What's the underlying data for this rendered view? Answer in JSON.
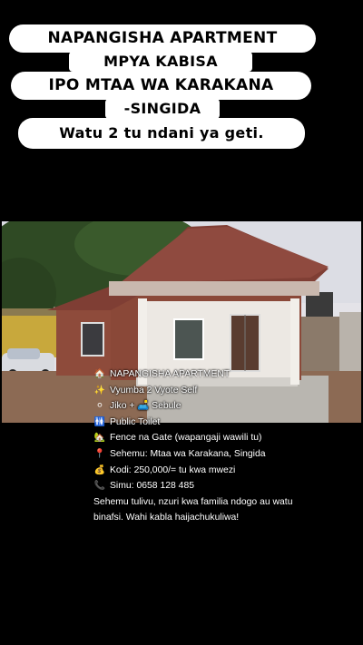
{
  "headline": {
    "line1": "NAPANGISHA APARTMENT",
    "line2": "MPYA KABISA",
    "line3": "IPO MTAA WA KARAKANA",
    "line4": "-SINGIDA",
    "line5": "Watu 2 tu ndani ya geti."
  },
  "photo": {
    "subject": "house-photo"
  },
  "post": {
    "items": [
      {
        "icon": "house-icon",
        "glyph": "🏠",
        "text": "NAPANGISHA APARTMENT"
      },
      {
        "icon": "sparkles-icon",
        "glyph": "✨",
        "text": "Vyumba 2 Vyote Self"
      },
      {
        "icon": "kitchen-icon",
        "glyph": "⚪",
        "text": "Jiko + 🛋️ Sebule"
      },
      {
        "icon": "restroom-icon",
        "glyph": "🚻",
        "text": "Public Toilet"
      },
      {
        "icon": "house-garden-icon",
        "glyph": "🏡",
        "text": "Fence na Gate (wapangaji wawili tu)"
      },
      {
        "icon": "pin-icon",
        "glyph": "📍",
        "text": "Sehemu: Mtaa wa Karakana, Singida"
      },
      {
        "icon": "money-bag-icon",
        "glyph": "💰",
        "text": "Kodi: 250,000/= tu kwa mwezi"
      },
      {
        "icon": "phone-icon",
        "glyph": "📞",
        "text": "Simu: 0658 128 485"
      }
    ],
    "paragraph": "Sehemu tulivu, nzuri kwa familia ndogo au watu binafsi. Wahi kabla haijachukuliwa!"
  },
  "colors": {
    "background": "#000000",
    "pill": "#ffffff",
    "roof": "#8a4a3a",
    "wall": "#8e4b3b",
    "sky": "#e8e6ea"
  }
}
